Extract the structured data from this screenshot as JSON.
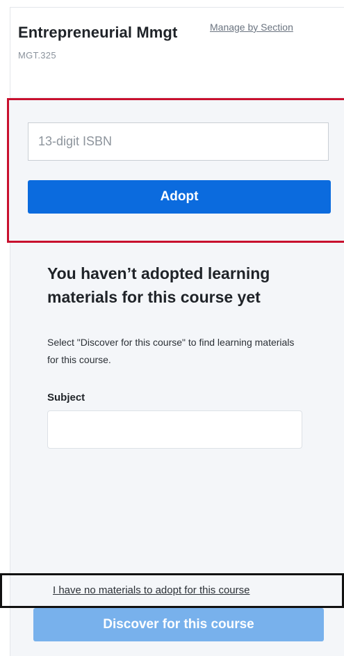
{
  "course": {
    "title": "Entrepreneurial Mmgt",
    "manage_link": "Manage by Section",
    "code": "MGT.325"
  },
  "adopt": {
    "isbn_placeholder": "13-digit ISBN",
    "isbn_value": "",
    "adopt_label": "Adopt"
  },
  "empty_state": {
    "heading": "You haven’t adopted learning materials for this course yet",
    "description": "Select \"Discover for this course\" to find learning materials for this course.",
    "subject_label": "Subject",
    "subject_value": ""
  },
  "footer": {
    "no_materials_link": "I have no materials to adopt for this course",
    "discover_label": "Discover for this course"
  },
  "colors": {
    "primary_blue": "#0b6bde",
    "disabled_blue": "#78b1ec",
    "highlight_red": "#c8102e",
    "highlight_black": "#111111"
  }
}
